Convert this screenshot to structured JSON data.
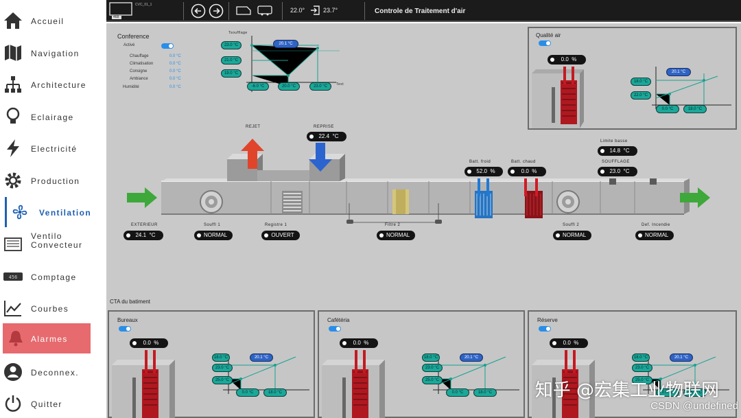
{
  "sidebar": {
    "items": [
      {
        "label": "Accueil",
        "icon": "home-icon"
      },
      {
        "label": "Navigation",
        "icon": "map-icon"
      },
      {
        "label": "Architecture",
        "icon": "network-icon"
      },
      {
        "label": "Eclairage",
        "icon": "lightbulb-icon"
      },
      {
        "label": "Electricité",
        "icon": "lightning-icon"
      },
      {
        "label": "Production",
        "icon": "gear-icon"
      },
      {
        "label": "Ventilation",
        "icon": "fan-icon"
      },
      {
        "label": "Ventilo Convecteur",
        "icon": "fancoil-icon"
      },
      {
        "label": "Comptage",
        "icon": "meter-icon"
      },
      {
        "label": "Courbes",
        "icon": "chart-icon"
      },
      {
        "label": "Alarmes",
        "icon": "bell-icon"
      },
      {
        "label": "Deconnex.",
        "icon": "user-icon"
      },
      {
        "label": "Quitter",
        "icon": "power-icon"
      }
    ]
  },
  "topbar": {
    "temp_left": "22.0°",
    "temp_right": "23.7°",
    "title": "Controle de Traitement d'air",
    "device": "CVC_01_1",
    "meter": "468"
  },
  "conference": {
    "title": "Conference",
    "toggle_label": "Activé",
    "rows": [
      {
        "label": "Chauffage",
        "value": "0.0 °C"
      },
      {
        "label": "Climatisation",
        "value": "0.0 °C"
      },
      {
        "label": "Consigne",
        "value": "0.0 °C"
      },
      {
        "label": "Ambiance",
        "value": "0.0 °C"
      },
      {
        "label": "Humidité",
        "value": "0.0 °C"
      }
    ],
    "curve": {
      "left": [
        "23.0 °C",
        "21.0 °C",
        "19.0 °C"
      ],
      "top": "20.1 °C",
      "bottom": [
        "-6.0 °C",
        "20.0 °C",
        "23.0 °C"
      ],
      "ylabel": "Tsoufflage",
      "xlabel": "Text"
    }
  },
  "qualite": {
    "title": "Qualité air",
    "valve": "0.0",
    "unit": "%",
    "curve": {
      "left": [
        "18.0 °C",
        "22.0 °C"
      ],
      "top": "20.1 °C",
      "bottom": [
        "0.0 °C",
        "18.0 °C"
      ]
    }
  },
  "main": {
    "rejet_label": "REJET",
    "reprise_label": "REPRISE",
    "reprise_value": "22.4",
    "reprise_unit": "°C",
    "ext_label": "EXTERIEUR",
    "ext_value": "24.1",
    "ext_unit": "°C",
    "souffl1_label": "Souffl 1",
    "souffl1_value": "NORMAL",
    "registre_label": "Registre 1",
    "registre_value": "OUVERT",
    "filtre_label": "Filtre 2",
    "filtre_value": "NORMAL",
    "bat_froid_label": "Batt. froid",
    "bat_froid_value": "52.0",
    "bat_froid_unit": "%",
    "bat_chaud_label": "Batt. chaud",
    "bat_chaud_value": "0.0",
    "bat_chaud_unit": "%",
    "limite_label": "Limite basse",
    "limite_value": "14.8",
    "limite_unit": "°C",
    "soufflage_label": "SOUFFLAGE",
    "soufflage_value": "23.0",
    "soufflage_unit": "°C",
    "souffl2_label": "Souffl 2",
    "souffl2_value": "NORMAL",
    "defauts_label": "Def. Incendie",
    "defauts_value": "NORMAL"
  },
  "section_title": "CTA du batiment",
  "bottom_panels": [
    {
      "title": "Bureaux",
      "valve": "0.0",
      "unit": "%",
      "left": [
        "18.0 °C",
        "23.0 °C",
        "25.0 °C"
      ],
      "top": "20.1 °C",
      "bottom": [
        "0.0 °C",
        "18.0 °C"
      ]
    },
    {
      "title": "Cafétéria",
      "valve": "0.0",
      "unit": "%",
      "left": [
        "18.0 °C",
        "23.0 °C",
        "25.0 °C"
      ],
      "top": "20.1 °C",
      "bottom": [
        "0.0 °C",
        "18.0 °C"
      ]
    },
    {
      "title": "Réserve",
      "valve": "0.0",
      "unit": "%",
      "left": [
        "18.0 °C",
        "23.0 °C",
        "25.0 °C"
      ],
      "top": "20.1 °C",
      "bottom": [
        "0.0 °C",
        "18.0 °C"
      ]
    }
  ],
  "watermark": "知乎 @宏集工业物联网",
  "csdn": "CSDN @undefined",
  "colors": {
    "accent": "#1d5fb4",
    "alarm": "#e66a6e",
    "teal": "#1ba89a",
    "blue_pill": "#2f63c4",
    "toggle": "#2a8ee8"
  }
}
